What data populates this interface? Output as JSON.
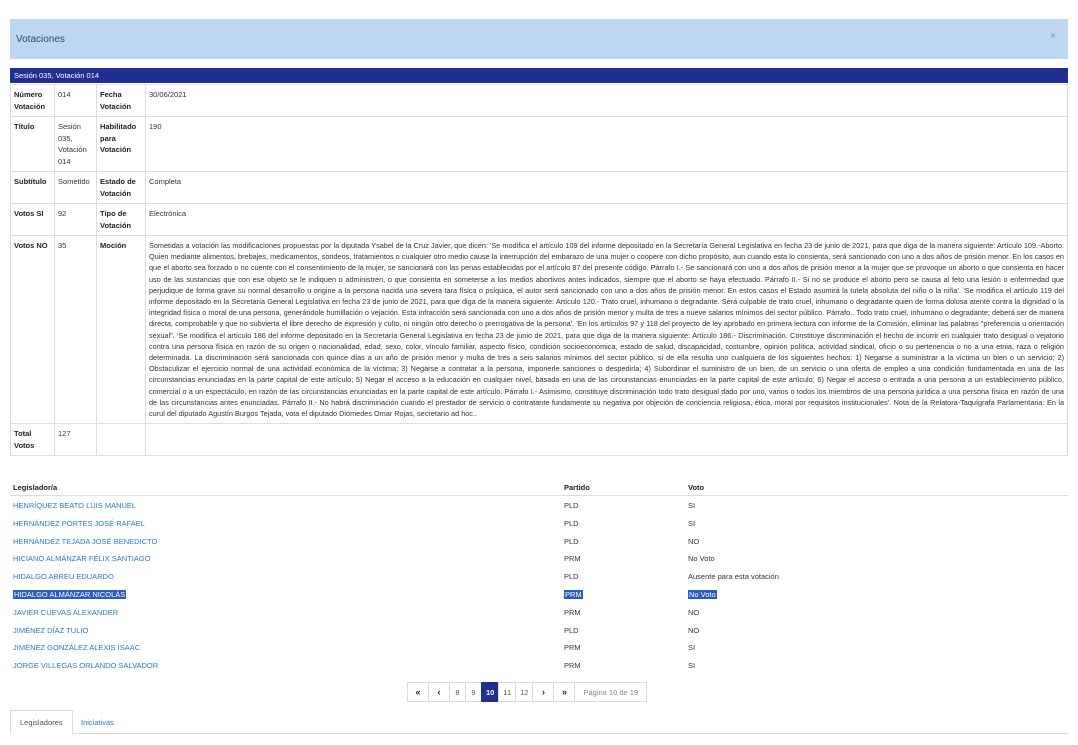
{
  "modal": {
    "title": "Votaciones",
    "close_label": "×"
  },
  "session_title": "Sesión 035, Votación 014",
  "detail": {
    "numero_label": "Número Votación",
    "numero_value": "014",
    "fecha_label": "Fecha Votación",
    "fecha_value": "30/06/2021",
    "titulo_label": "Título",
    "titulo_value": "Sesión 035, Votación 014",
    "habilitado_label": "Habilitado para Votación",
    "habilitado_value": "190",
    "subtitulo_label": "Subtítulo",
    "subtitulo_value": "Sometido",
    "estado_label": "Estado de Votación",
    "estado_value": "Completa",
    "votos_si_label": "Votos SI",
    "votos_si_value": "92",
    "tipo_label": "Tipo de Votación",
    "tipo_value": "Electrónica",
    "votos_no_label": "Votos NO",
    "votos_no_value": "35",
    "mocion_label": "Moción",
    "mocion_value": "Sometidas a votación las modificaciones propuestas por la diputada Ysabel de la Cruz Javier, que dicen: 'Se modifica el artículo 109 del informe depositado en la Secretaría General Legislativa en fecha 23 de junio de 2021, para que diga de la manera siguiente: Artículo 109.-Aborto. Quien mediante alimentos, brebajes, medicamentos, sondeos, tratamientos o cualquier otro medio cause la interrupción del embarazo de una mujer o coopere con dicho propósito, aun cuando esta lo consienta, será sancionado con uno a dos años de prisión menor. En los casos en que el aborto sea forzado o no cuente con el consentimiento de la mujer, se sancionará con las penas establecidas por el artículo 87 del presente código. Párrafo I.- Se sancionará con uno a dos años de prisión menor a la mujer que se provoque un aborto o que consienta en hacer uso de las sustancias que con ese objeto se le indiquen o administren, o que consienta en someterse a los medios abortivos antes indicados, siempre que el aborto se haya efectuado. Párrafo II.- Si no se produce el aborto pero se causa al feto una lesión o enfermedad que perjudique de forma grave su normal desarrollo u origine a la persona nacida una severa tara física o psíquica, el autor será sancionado con uno a dos años de prisión menor. En estos casos el Estado asumirá la tutela absoluta del niño o la niña'. 'Se modifica el artículo 119 del informe depositado en la Secretaría General Legislativa en fecha 23 de junio de 2021, para que diga de la manera siguiente: Artículo 120.- Trato cruel, inhumano o degradante. Será culpable de trato cruel, inhumano o degradante quien de forma dolosa atente contra la dignidad o la integridad física o moral de una persona, generándole humillación o vejación. Esta infracción será sancionada con uno a dos años de prisión menor y multa de tres a nueve salarios mínimos del sector público. Párrafo.. Todo trato cruel, inhumano o degradante; deberá ser de manera directa, comprobable y que no subvierta el libre derecho de expresión y culto, ni ningún otro derecho o prerrogativa de la persona'. 'En los artículos 97 y 118 del proyecto de ley aprobado en primera lectura con informe de la Comisión, eliminar las palabras \"preferencia u orientación sexual\". 'Se modifica el artículo 186 del informe depositado en la Secretaría General Legislativa en fecha 23 de junio de 2021, para que diga de la manera siguiente: Artículo 186.- Discriminación. Constituye discriminación el hecho de incurrir en cualquier trato desigual o vejatorio contra una persona física en razón de su origen o nacionalidad, edad, sexo, color, vínculo familiar, aspecto físico, condición socioeconómica, estado de salud, discapacidad, costumbre, opinión política, actividad sindical, oficio o su pertenencia o no a una etnia, raza o religión determinada. La discriminación será sancionada con quince días a un año de prisión menor y multa de tres a seis salarios mínimos del sector público, si de ella resulta uno cualquiera de los siguientes hechos: 1) Negarse a suministrar a la víctima un bien o un servicio; 2) Obstaculizar el ejercicio normal de una actividad económica de la víctima; 3) Negarse a contratar a la persona, imponerle sanciones o despedirla; 4) Subordinar el suministro de un bien, de un servicio o una oferta de empleo a una condición fundamentada en una de las circunstancias enunciadas en la parte capital de este artículo; 5) Negar el acceso a la educación en cualquier nivel, basada en una de las circunstancias enunciadas en la parte capital de este artículo; 6) Negar el acceso o entrada a una persona a un establecimiento público, comercial o a un espectáculo, en razón de las circunstancias enunciadas en la parte capital de este artículo. Párrafo I.- Asimismo, constituye discriminación todo trato desigual dado por uno, varios o todos los miembros de una persona jurídica a una persona física en razón de una de las circunstancias antes enunciadas. Párrafo II.- No habrá discriminación cuando el prestador de servicio o contratante fundamente su negativa por objeción de conciencia religiosa, ética, moral por requisitos institucionales'. Nota de la Relatora-Taquígrafa Parlamentaria: En la curul del diputado Agustín Burgos Tejada, vota el diputado Diómedes Omar Rojas, secretario ad hoc..",
    "total_label": "Total Votos",
    "total_value": "127"
  },
  "legislators": {
    "col_name": "Legislador/a",
    "col_party": "Partido",
    "col_vote": "Voto",
    "rows": [
      {
        "name": "HENRÍQUEZ BEATO LUIS MANUEL",
        "party": "PLD",
        "vote": "SI"
      },
      {
        "name": "HERNÁNDEZ PORTES JOSÉ RAFAEL",
        "party": "PLD",
        "vote": "SI"
      },
      {
        "name": "HERNÁNDEZ TEJADA JOSÉ BENEDICTO",
        "party": "PLD",
        "vote": "NO"
      },
      {
        "name": "HICIANO ALMÁNZAR FÉLIX SANTIAGO",
        "party": "PRM",
        "vote": "No Voto"
      },
      {
        "name": "HIDALGO ABREU EDUARDO",
        "party": "PLD",
        "vote": "Ausente para esta votación"
      },
      {
        "name": "HIDALGO ALMÁNZAR NICOLÁS",
        "party": "PRM",
        "vote": "No Voto"
      },
      {
        "name": "JAVIER CUEVAS ALEXANDER",
        "party": "PRM",
        "vote": "NO"
      },
      {
        "name": "JIMÉNEZ DÍAZ TULIO",
        "party": "PLD",
        "vote": "NO"
      },
      {
        "name": "JIMÉNEZ GONZÁLEZ ALEXIS ISAAC",
        "party": "PRM",
        "vote": "SI"
      },
      {
        "name": "JORGE VILLEGAS ORLANDO SALVADOR",
        "party": "PRM",
        "vote": "SI"
      }
    ]
  },
  "pagination": {
    "first": "«",
    "prev": "‹",
    "pages": [
      "8",
      "9",
      "10",
      "11",
      "12"
    ],
    "current": "10",
    "next": "›",
    "last": "»",
    "info": "Página 10 de 19"
  },
  "tabs": {
    "legisladores": "Legisladores",
    "iniciativas": "Iniciativas"
  }
}
